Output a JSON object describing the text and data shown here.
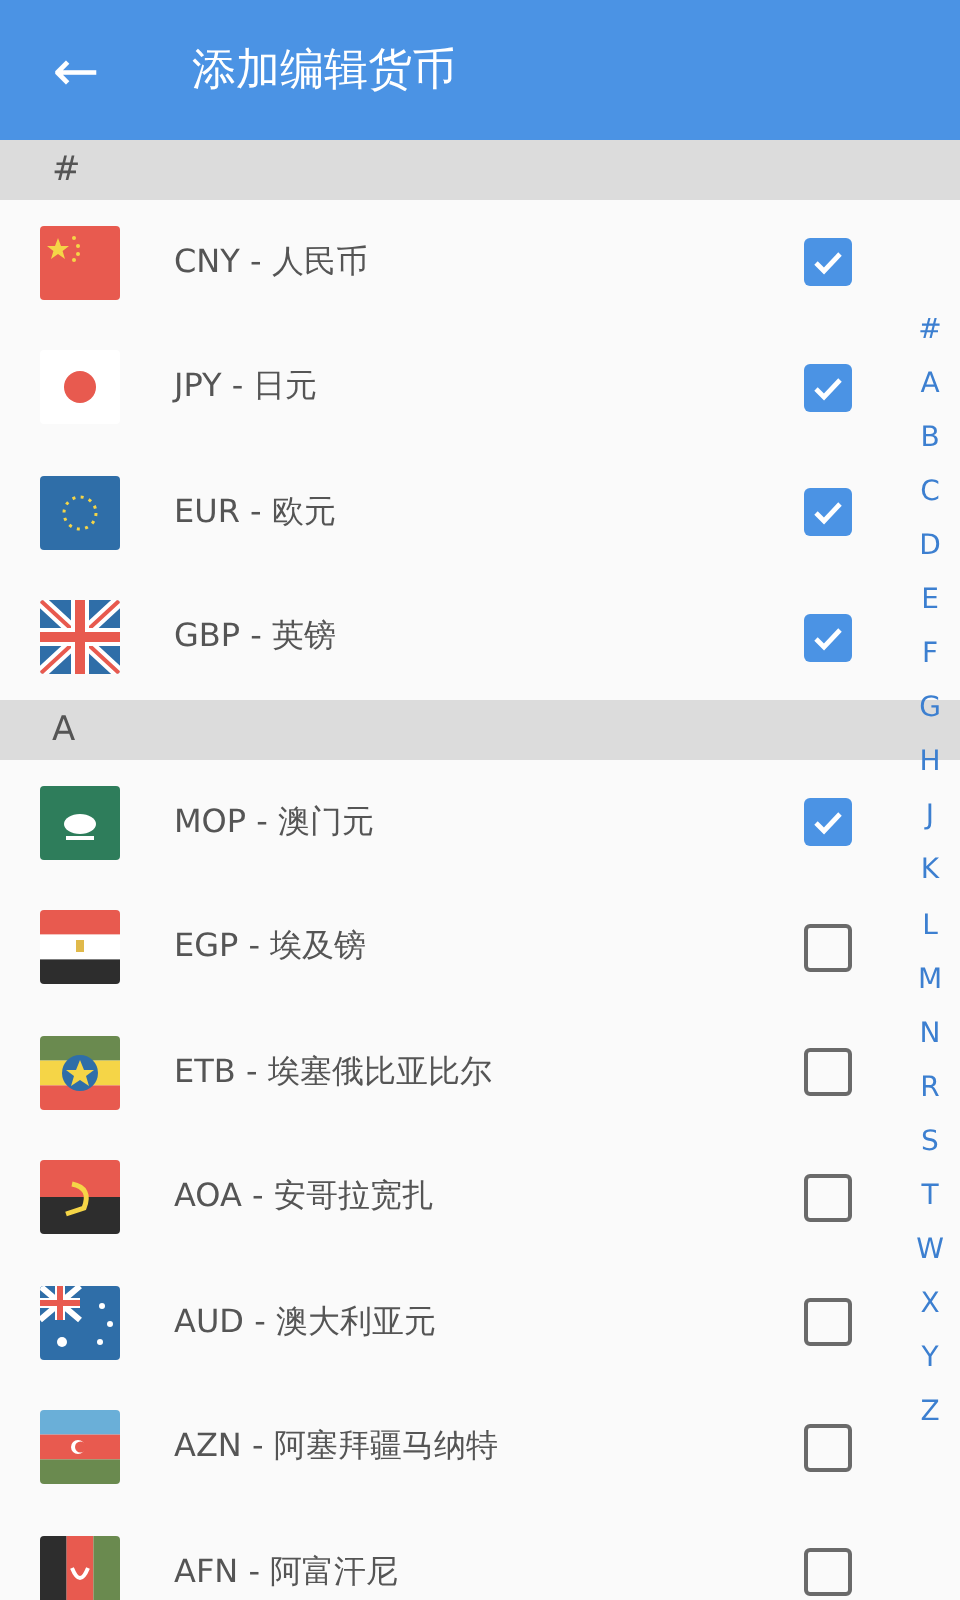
{
  "app_bar": {
    "back": "←",
    "title": "添加编辑货币"
  },
  "sections": [
    {
      "header": "#",
      "items": [
        {
          "label": "CNY - 人民币",
          "checked": true
        },
        {
          "label": "JPY - 日元",
          "checked": true
        },
        {
          "label": "EUR - 欧元",
          "checked": true
        },
        {
          "label": "GBP - 英镑",
          "checked": true
        }
      ]
    },
    {
      "header": "A",
      "items": [
        {
          "label": "MOP - 澳门元",
          "checked": true
        },
        {
          "label": "EGP - 埃及镑",
          "checked": false
        },
        {
          "label": "ETB - 埃塞俄比亚比尔",
          "checked": false
        },
        {
          "label": "AOA - 安哥拉宽扎",
          "checked": false
        },
        {
          "label": "AUD - 澳大利亚元",
          "checked": false
        },
        {
          "label": "AZN - 阿塞拜疆马纳特",
          "checked": false
        },
        {
          "label": "AFN - 阿富汗尼",
          "checked": false
        }
      ]
    }
  ],
  "index": [
    "#",
    "A",
    "B",
    "C",
    "D",
    "E",
    "F",
    "G",
    "H",
    "J",
    "K",
    "L",
    "M",
    "N",
    "R",
    "S",
    "T",
    "W",
    "X",
    "Y",
    "Z"
  ]
}
